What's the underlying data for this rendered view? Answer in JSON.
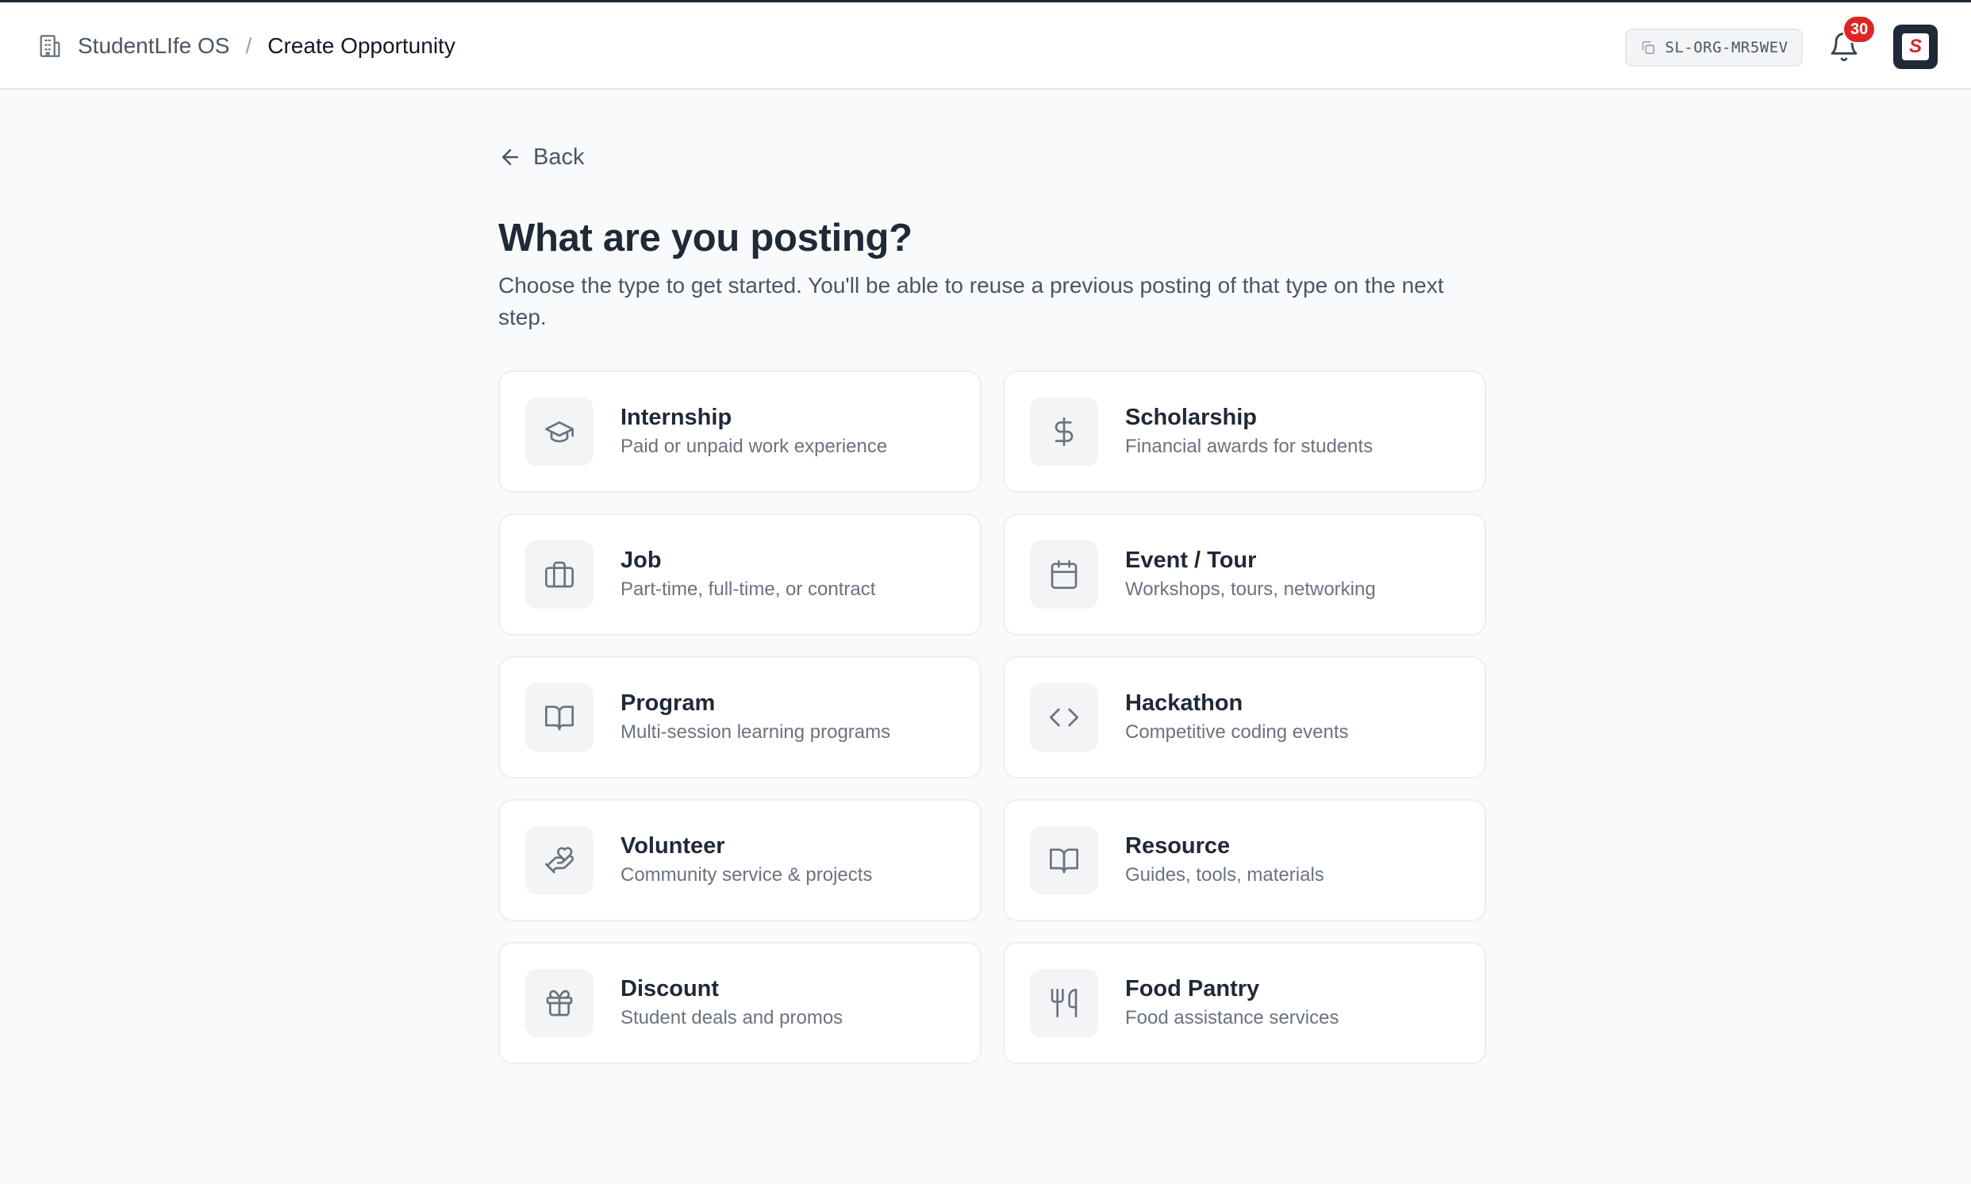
{
  "header": {
    "org_name": "StudentLIfe OS",
    "separator": "/",
    "page_name": "Create Opportunity",
    "org_code": "SL-ORG-MR5WEV",
    "notification_count": "30",
    "avatar_letter": "S"
  },
  "page": {
    "back_label": "Back",
    "title": "What are you posting?",
    "subtitle": "Choose the type to get started. You'll be able to reuse a previous posting of that type on the next step."
  },
  "types": [
    {
      "title": "Internship",
      "desc": "Paid or unpaid work experience",
      "icon": "graduation-cap-icon"
    },
    {
      "title": "Scholarship",
      "desc": "Financial awards for students",
      "icon": "dollar-icon"
    },
    {
      "title": "Job",
      "desc": "Part-time, full-time, or contract",
      "icon": "briefcase-icon"
    },
    {
      "title": "Event / Tour",
      "desc": "Workshops, tours, networking",
      "icon": "calendar-icon"
    },
    {
      "title": "Program",
      "desc": "Multi-session learning programs",
      "icon": "book-open-icon"
    },
    {
      "title": "Hackathon",
      "desc": "Competitive coding events",
      "icon": "code-icon"
    },
    {
      "title": "Volunteer",
      "desc": "Community service & projects",
      "icon": "hand-heart-icon"
    },
    {
      "title": "Resource",
      "desc": "Guides, tools, materials",
      "icon": "book-open-icon"
    },
    {
      "title": "Discount",
      "desc": "Student deals and promos",
      "icon": "gift-icon"
    },
    {
      "title": "Food Pantry",
      "desc": "Food assistance services",
      "icon": "utensils-icon"
    }
  ]
}
